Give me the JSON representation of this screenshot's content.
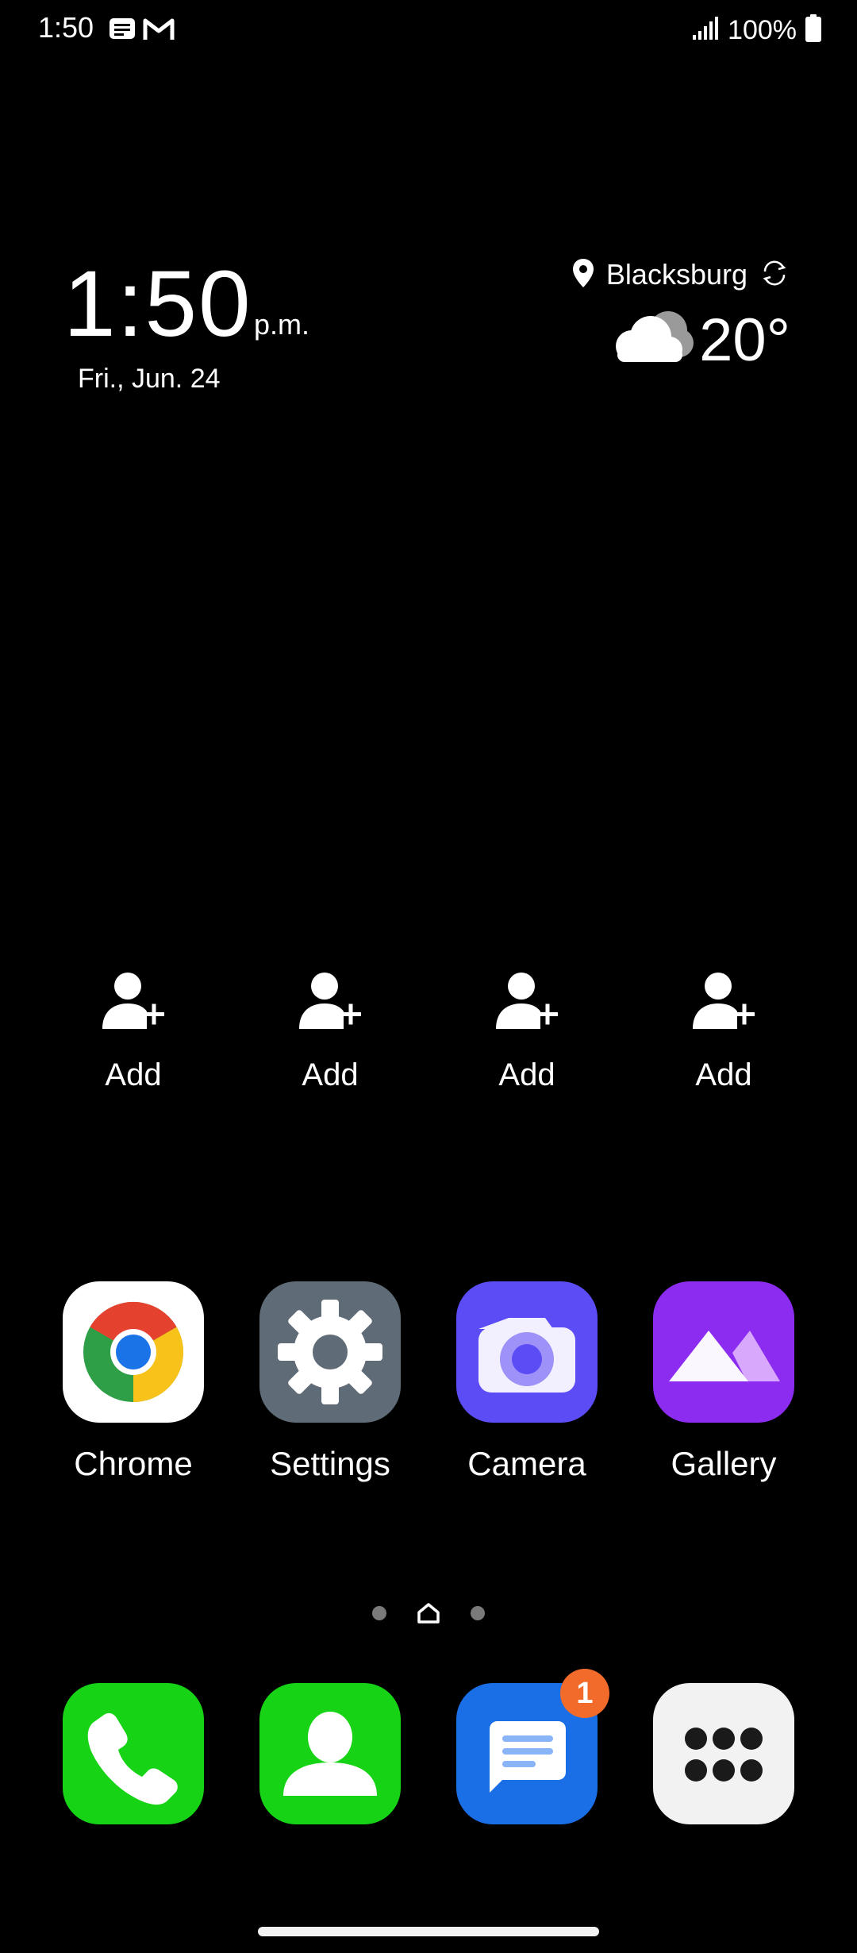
{
  "status_bar": {
    "time": "1:50",
    "battery_percent": "100%",
    "notification_icons": [
      "message-notification-icon",
      "gmail-notification-icon"
    ],
    "signal_icon": "signal-icon",
    "battery_icon": "battery-full-icon"
  },
  "clock_widget": {
    "time": "1:50",
    "ampm": "p.m.",
    "date": "Fri., Jun. 24"
  },
  "weather_widget": {
    "location": "Blacksburg",
    "temperature": "20°",
    "condition_icon": "cloudy-icon",
    "refresh_icon": "refresh-icon",
    "location_icon": "location-pin-icon"
  },
  "contacts": [
    {
      "label": "Add",
      "icon": "add-contact-icon"
    },
    {
      "label": "Add",
      "icon": "add-contact-icon"
    },
    {
      "label": "Add",
      "icon": "add-contact-icon"
    },
    {
      "label": "Add",
      "icon": "add-contact-icon"
    }
  ],
  "apps": [
    {
      "label": "Chrome",
      "icon": "chrome-icon",
      "color": "#ffffff"
    },
    {
      "label": "Settings",
      "icon": "gear-icon",
      "color": "#5f6b76"
    },
    {
      "label": "Camera",
      "icon": "camera-icon",
      "color": "#5b4cf5"
    },
    {
      "label": "Gallery",
      "icon": "gallery-icon",
      "color": "#8b2cf0"
    }
  ],
  "page_indicator": {
    "pages": 3,
    "current": 2
  },
  "dock": [
    {
      "name": "Phone",
      "icon": "phone-icon",
      "color": "#16d316"
    },
    {
      "name": "Contacts",
      "icon": "contacts-icon",
      "color": "#16d316"
    },
    {
      "name": "Messages",
      "icon": "messages-icon",
      "color": "#1a6fe6",
      "badge": "1"
    },
    {
      "name": "Apps",
      "icon": "app-drawer-icon",
      "color": "#f2f2f2"
    }
  ],
  "colors": {
    "background": "#000000",
    "badge": "#f26b2b"
  }
}
